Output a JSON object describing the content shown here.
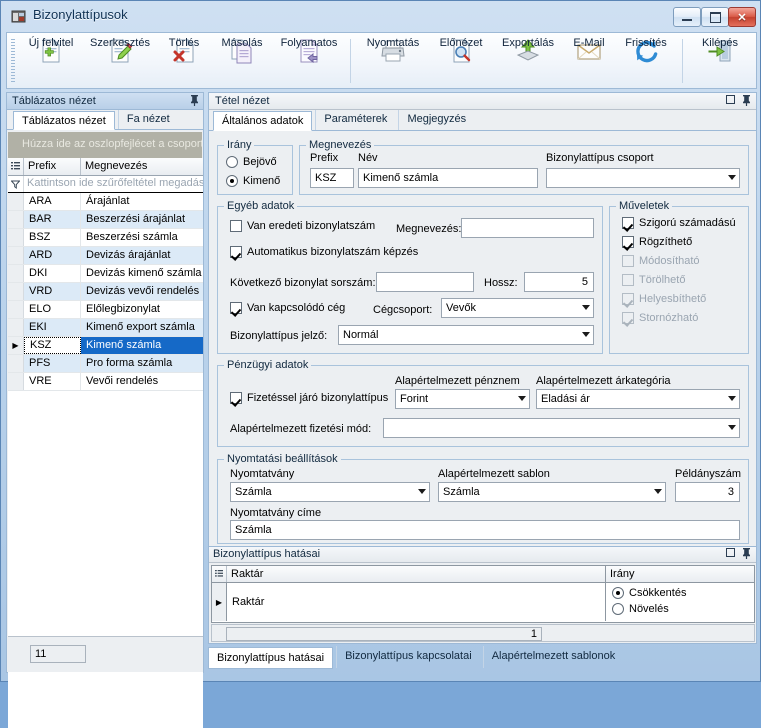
{
  "window": {
    "title": "Bizonylattípusok",
    "icon": "app-window-icon",
    "buttons": {
      "minimize": "–",
      "maximize": "□",
      "close": "✕"
    }
  },
  "toolbar": {
    "items": [
      {
        "label": "Új felvitel",
        "icon": "new-document-icon"
      },
      {
        "label": "Szerkesztés",
        "icon": "edit-pencil-icon"
      },
      {
        "label": "Törlés",
        "icon": "delete-document-icon"
      },
      {
        "label": "Másolás",
        "icon": "copy-icon"
      },
      {
        "label": "Folyamatos",
        "icon": "continuous-icon"
      },
      {
        "label": "Nyomtatás",
        "icon": "printer-icon"
      },
      {
        "label": "Előnézet",
        "icon": "preview-magnifier-icon"
      },
      {
        "label": "Exportálás",
        "icon": "export-icon"
      },
      {
        "label": "E-Mail",
        "icon": "envelope-icon"
      },
      {
        "label": "Frissítés",
        "icon": "refresh-icon"
      },
      {
        "label": "Kilépés",
        "icon": "exit-door-icon"
      }
    ]
  },
  "left_panel": {
    "caption": "Táblázatos nézet",
    "pin_icon": "pin-icon",
    "tabs": [
      {
        "label": "Táblázatos nézet",
        "active": true
      },
      {
        "label": "Fa nézet",
        "active": false
      }
    ],
    "group_hint": "Húzza ide az oszlopfejlécet a csoportc",
    "columns": [
      "Prefix",
      "Megnevezés"
    ],
    "filter_hint": "Kattintson ide szűrőfeltétel megadásá",
    "rows": [
      {
        "prefix": "ARA",
        "name": "Árajánlat"
      },
      {
        "prefix": "BAR",
        "name": "Beszerzési árajánlat"
      },
      {
        "prefix": "BSZ",
        "name": "Beszerzési számla"
      },
      {
        "prefix": "ARD",
        "name": "Devizás árajánlat"
      },
      {
        "prefix": "DKI",
        "name": "Devizás kimenő számla"
      },
      {
        "prefix": "VRD",
        "name": "Devizás vevői rendelés"
      },
      {
        "prefix": "ELO",
        "name": "Előlegbizonylat"
      },
      {
        "prefix": "EKI",
        "name": "Kimenő export számla"
      },
      {
        "prefix": "KSZ",
        "name": "Kimenő számla"
      },
      {
        "prefix": "PFS",
        "name": "Pro forma számla"
      },
      {
        "prefix": "VRE",
        "name": "Vevői rendelés"
      }
    ],
    "selected_index": 8,
    "row_count": "11"
  },
  "detail_panel": {
    "caption": "Tétel nézet",
    "restore_icon": "restore-icon",
    "pin_icon": "pin-icon",
    "tabs": [
      {
        "label": "Általános adatok",
        "active": true
      },
      {
        "label": "Paraméterek",
        "active": false
      },
      {
        "label": "Megjegyzés",
        "active": false
      }
    ],
    "irany": {
      "legend": "Irány",
      "options": [
        {
          "label": "Bejövő",
          "selected": false
        },
        {
          "label": "Kimenő",
          "selected": true
        }
      ]
    },
    "megnevezes": {
      "legend": "Megnevezés",
      "prefix_label": "Prefix",
      "prefix_value": "KSZ",
      "nev_label": "Név",
      "nev_value": "Kimenő számla",
      "csoport_label": "Bizonylattípus csoport",
      "csoport_value": ""
    },
    "egyeb": {
      "legend": "Egyéb adatok",
      "van_eredeti_label": "Van eredeti bizonylatszám",
      "van_eredeti_checked": false,
      "megnevezes_label": "Megnevezés:",
      "megnevezes_value": "",
      "auto_label": "Automatikus bizonylatszám képzés",
      "auto_checked": true,
      "kovetkezo_label": "Következő bizonylat sorszám:",
      "kovetkezo_value": "",
      "hossz_label": "Hossz:",
      "hossz_value": "5",
      "kapcsolodo_label": "Van kapcsolódó cég",
      "kapcsolodo_checked": true,
      "cegcsoport_label": "Cégcsoport:",
      "cegcsoport_value": "Vevők",
      "jelzo_label": "Bizonylattípus jelző:",
      "jelzo_value": "Normál"
    },
    "muveletek": {
      "legend": "Műveletek",
      "items": [
        {
          "label": "Szigorú számadású",
          "checked": true,
          "disabled": false
        },
        {
          "label": "Rögzíthető",
          "checked": true,
          "disabled": false
        },
        {
          "label": "Módosítható",
          "checked": false,
          "disabled": true
        },
        {
          "label": "Törölhető",
          "checked": false,
          "disabled": true
        },
        {
          "label": "Helyesbíthető",
          "checked": true,
          "disabled": true
        },
        {
          "label": "Stornózható",
          "checked": true,
          "disabled": true
        }
      ]
    },
    "penzugyi": {
      "legend": "Pénzügyi adatok",
      "fizetessel_label": "Fizetéssel járó bizonylattípus",
      "fizetessel_checked": true,
      "penznem_label": "Alapértelmezett pénznem",
      "penznem_value": "Forint",
      "arkategoria_label": "Alapértelmezett árkategória",
      "arkategoria_value": "Eladási ár",
      "fizetesimod_label": "Alapértelmezett fizetési mód:",
      "fizetesimod_value": ""
    },
    "nyomtatas": {
      "legend": "Nyomtatási beállítások",
      "nyomtatvany_label": "Nyomtatvány",
      "nyomtatvany_value": "Számla",
      "sablon_label": "Alapértelmezett sablon",
      "sablon_value": "Számla",
      "peldanyszam_label": "Példányszám",
      "peldanyszam_value": "3",
      "cime_label": "Nyomtatvány címe",
      "cime_value": "Számla"
    }
  },
  "bottom_panel": {
    "caption": "Bizonylattípus hatásai",
    "restore_icon": "restore-icon",
    "pin_icon": "pin-icon",
    "columns": [
      "Raktár",
      "Irány"
    ],
    "row": {
      "raktar": "Raktár",
      "irany_options": [
        {
          "label": "Csökkentés",
          "selected": true
        },
        {
          "label": "Növelés",
          "selected": false
        }
      ]
    },
    "footer_value": "1",
    "tabs": [
      {
        "label": "Bizonylattípus hatásai",
        "active": true
      },
      {
        "label": "Bizonylattípus kapcsolatai",
        "active": false
      },
      {
        "label": "Alapértelmezett sablonok",
        "active": false
      }
    ]
  },
  "colors": {
    "accent": "#1569c7",
    "window_frame": "#a9c6e4",
    "panel_bg": "#eceff2",
    "alt_row": "#dceaf7",
    "group_bar": "#b1b1a6",
    "close_button": "#c4412f"
  }
}
